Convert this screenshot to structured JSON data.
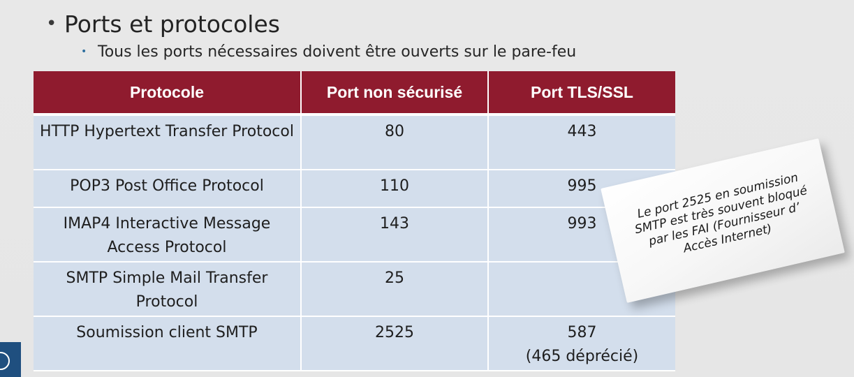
{
  "heading": {
    "bullet1": "Ports et protocoles",
    "bullet2": "Tous les ports nécessaires doivent être ouverts sur le pare-feu"
  },
  "table": {
    "headers": [
      "Protocole",
      "Port non sécurisé",
      "Port TLS/SSL"
    ],
    "rows": [
      {
        "protocol": "HTTP Hypertext Transfer Protocol",
        "port_plain": "80",
        "port_tls": "443"
      },
      {
        "protocol": "POP3 Post Office Protocol",
        "port_plain": "110",
        "port_tls": "995"
      },
      {
        "protocol": "IMAP4 Interactive Message Access Protocol",
        "port_plain": "143",
        "port_tls": "993"
      },
      {
        "protocol": "SMTP Simple Mail Transfer Protocol",
        "port_plain": "25",
        "port_tls": ""
      },
      {
        "protocol": "Soumission client SMTP",
        "port_plain": "2525",
        "port_tls": "587",
        "port_tls_note": "(465 déprécié)"
      }
    ]
  },
  "note": {
    "text": "Le port 2525 en soumission SMTP est très souvent bloqué par les FAI (Fournisseur d’ Accès Internet)"
  },
  "colors": {
    "header_bg": "#8f1b2e",
    "row_bg": "#d3deec",
    "bullet_accent": "#2d6e9e",
    "logo_bg": "#1f4f7f"
  }
}
